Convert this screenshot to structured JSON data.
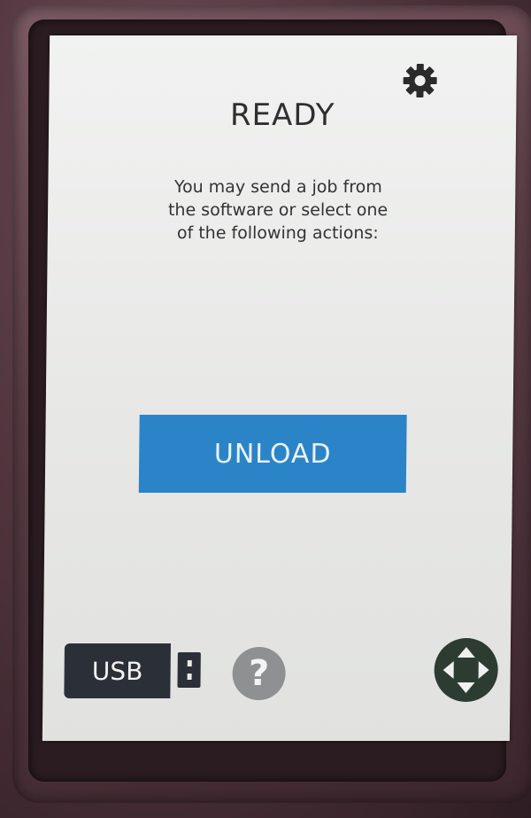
{
  "status": {
    "title": "READY"
  },
  "message": {
    "lines": [
      "You may send a job from",
      "the software or select one",
      "of the following actions:"
    ]
  },
  "actions": {
    "unload_label": "UNLOAD"
  },
  "footer": {
    "usb_label": "USB",
    "help_label": "?"
  },
  "icons": {
    "settings": "gear-icon",
    "usb": "usb-plug-icon",
    "help": "help-icon",
    "move": "move-arrows-icon"
  },
  "colors": {
    "accent": "#2b84c8",
    "usb_button": "#2b3038",
    "help_button": "#8f9092",
    "move_button": "#2c3c31"
  }
}
